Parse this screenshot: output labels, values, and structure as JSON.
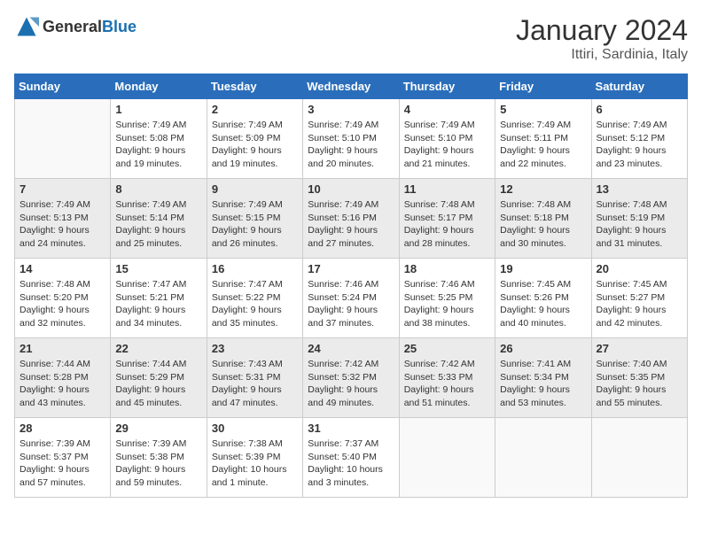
{
  "logo": {
    "general": "General",
    "blue": "Blue"
  },
  "header": {
    "month_year": "January 2024",
    "location": "Ittiri, Sardinia, Italy"
  },
  "days_of_week": [
    "Sunday",
    "Monday",
    "Tuesday",
    "Wednesday",
    "Thursday",
    "Friday",
    "Saturday"
  ],
  "weeks": [
    [
      {
        "day": "",
        "info": ""
      },
      {
        "day": "1",
        "info": "Sunrise: 7:49 AM\nSunset: 5:08 PM\nDaylight: 9 hours\nand 19 minutes."
      },
      {
        "day": "2",
        "info": "Sunrise: 7:49 AM\nSunset: 5:09 PM\nDaylight: 9 hours\nand 19 minutes."
      },
      {
        "day": "3",
        "info": "Sunrise: 7:49 AM\nSunset: 5:10 PM\nDaylight: 9 hours\nand 20 minutes."
      },
      {
        "day": "4",
        "info": "Sunrise: 7:49 AM\nSunset: 5:10 PM\nDaylight: 9 hours\nand 21 minutes."
      },
      {
        "day": "5",
        "info": "Sunrise: 7:49 AM\nSunset: 5:11 PM\nDaylight: 9 hours\nand 22 minutes."
      },
      {
        "day": "6",
        "info": "Sunrise: 7:49 AM\nSunset: 5:12 PM\nDaylight: 9 hours\nand 23 minutes."
      }
    ],
    [
      {
        "day": "7",
        "info": "Sunrise: 7:49 AM\nSunset: 5:13 PM\nDaylight: 9 hours\nand 24 minutes."
      },
      {
        "day": "8",
        "info": "Sunrise: 7:49 AM\nSunset: 5:14 PM\nDaylight: 9 hours\nand 25 minutes."
      },
      {
        "day": "9",
        "info": "Sunrise: 7:49 AM\nSunset: 5:15 PM\nDaylight: 9 hours\nand 26 minutes."
      },
      {
        "day": "10",
        "info": "Sunrise: 7:49 AM\nSunset: 5:16 PM\nDaylight: 9 hours\nand 27 minutes."
      },
      {
        "day": "11",
        "info": "Sunrise: 7:48 AM\nSunset: 5:17 PM\nDaylight: 9 hours\nand 28 minutes."
      },
      {
        "day": "12",
        "info": "Sunrise: 7:48 AM\nSunset: 5:18 PM\nDaylight: 9 hours\nand 30 minutes."
      },
      {
        "day": "13",
        "info": "Sunrise: 7:48 AM\nSunset: 5:19 PM\nDaylight: 9 hours\nand 31 minutes."
      }
    ],
    [
      {
        "day": "14",
        "info": "Sunrise: 7:48 AM\nSunset: 5:20 PM\nDaylight: 9 hours\nand 32 minutes."
      },
      {
        "day": "15",
        "info": "Sunrise: 7:47 AM\nSunset: 5:21 PM\nDaylight: 9 hours\nand 34 minutes."
      },
      {
        "day": "16",
        "info": "Sunrise: 7:47 AM\nSunset: 5:22 PM\nDaylight: 9 hours\nand 35 minutes."
      },
      {
        "day": "17",
        "info": "Sunrise: 7:46 AM\nSunset: 5:24 PM\nDaylight: 9 hours\nand 37 minutes."
      },
      {
        "day": "18",
        "info": "Sunrise: 7:46 AM\nSunset: 5:25 PM\nDaylight: 9 hours\nand 38 minutes."
      },
      {
        "day": "19",
        "info": "Sunrise: 7:45 AM\nSunset: 5:26 PM\nDaylight: 9 hours\nand 40 minutes."
      },
      {
        "day": "20",
        "info": "Sunrise: 7:45 AM\nSunset: 5:27 PM\nDaylight: 9 hours\nand 42 minutes."
      }
    ],
    [
      {
        "day": "21",
        "info": "Sunrise: 7:44 AM\nSunset: 5:28 PM\nDaylight: 9 hours\nand 43 minutes."
      },
      {
        "day": "22",
        "info": "Sunrise: 7:44 AM\nSunset: 5:29 PM\nDaylight: 9 hours\nand 45 minutes."
      },
      {
        "day": "23",
        "info": "Sunrise: 7:43 AM\nSunset: 5:31 PM\nDaylight: 9 hours\nand 47 minutes."
      },
      {
        "day": "24",
        "info": "Sunrise: 7:42 AM\nSunset: 5:32 PM\nDaylight: 9 hours\nand 49 minutes."
      },
      {
        "day": "25",
        "info": "Sunrise: 7:42 AM\nSunset: 5:33 PM\nDaylight: 9 hours\nand 51 minutes."
      },
      {
        "day": "26",
        "info": "Sunrise: 7:41 AM\nSunset: 5:34 PM\nDaylight: 9 hours\nand 53 minutes."
      },
      {
        "day": "27",
        "info": "Sunrise: 7:40 AM\nSunset: 5:35 PM\nDaylight: 9 hours\nand 55 minutes."
      }
    ],
    [
      {
        "day": "28",
        "info": "Sunrise: 7:39 AM\nSunset: 5:37 PM\nDaylight: 9 hours\nand 57 minutes."
      },
      {
        "day": "29",
        "info": "Sunrise: 7:39 AM\nSunset: 5:38 PM\nDaylight: 9 hours\nand 59 minutes."
      },
      {
        "day": "30",
        "info": "Sunrise: 7:38 AM\nSunset: 5:39 PM\nDaylight: 10 hours\nand 1 minute."
      },
      {
        "day": "31",
        "info": "Sunrise: 7:37 AM\nSunset: 5:40 PM\nDaylight: 10 hours\nand 3 minutes."
      },
      {
        "day": "",
        "info": ""
      },
      {
        "day": "",
        "info": ""
      },
      {
        "day": "",
        "info": ""
      }
    ]
  ]
}
